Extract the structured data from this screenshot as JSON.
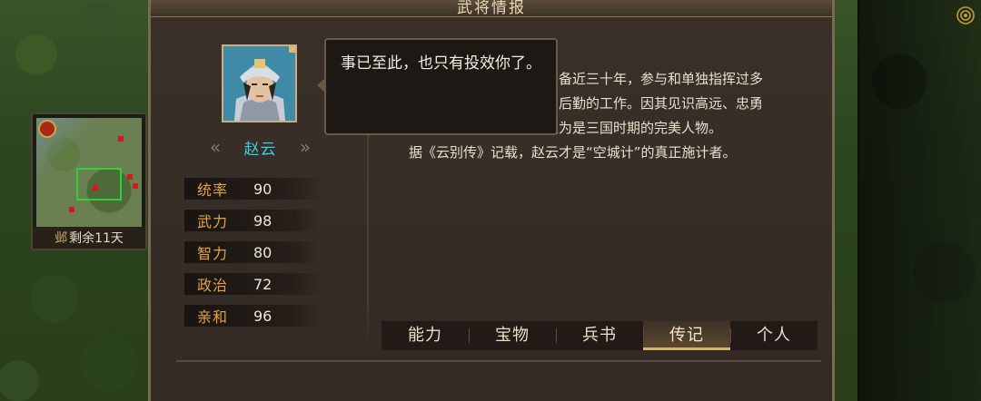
{
  "panel": {
    "title": "武将情报"
  },
  "minimap": {
    "city": "邺",
    "remaining": "剩余11天"
  },
  "hero": {
    "name": "赵云",
    "prev_icon": "chevron-left-icon",
    "next_icon": "chevron-right-icon"
  },
  "stats": [
    {
      "label": "统率",
      "value": "90"
    },
    {
      "label": "武力",
      "value": "98"
    },
    {
      "label": "智力",
      "value": "80"
    },
    {
      "label": "政治",
      "value": "72"
    },
    {
      "label": "亲和",
      "value": "96"
    }
  ],
  "speech": {
    "text": "事已至此，也只有投效你了。"
  },
  "bio": {
    "lines": [
      "刘备近三十年，参与和单独指挥过多",
      "的后勤的工作。因其见识高远、忠勇",
      "认为是三国时期的完美人物。",
      "据《云别传》记载，赵云才是“空城计”的真正施计者。"
    ]
  },
  "tabs": [
    {
      "label": "能力",
      "active": false
    },
    {
      "label": "宝物",
      "active": false
    },
    {
      "label": "兵书",
      "active": false
    },
    {
      "label": "传记",
      "active": true
    },
    {
      "label": "个人",
      "active": false
    }
  ],
  "colors": {
    "hero_name": "#34cfe0",
    "stat_label": "#e3a248",
    "active_tab_underline": "#d9b26a"
  }
}
